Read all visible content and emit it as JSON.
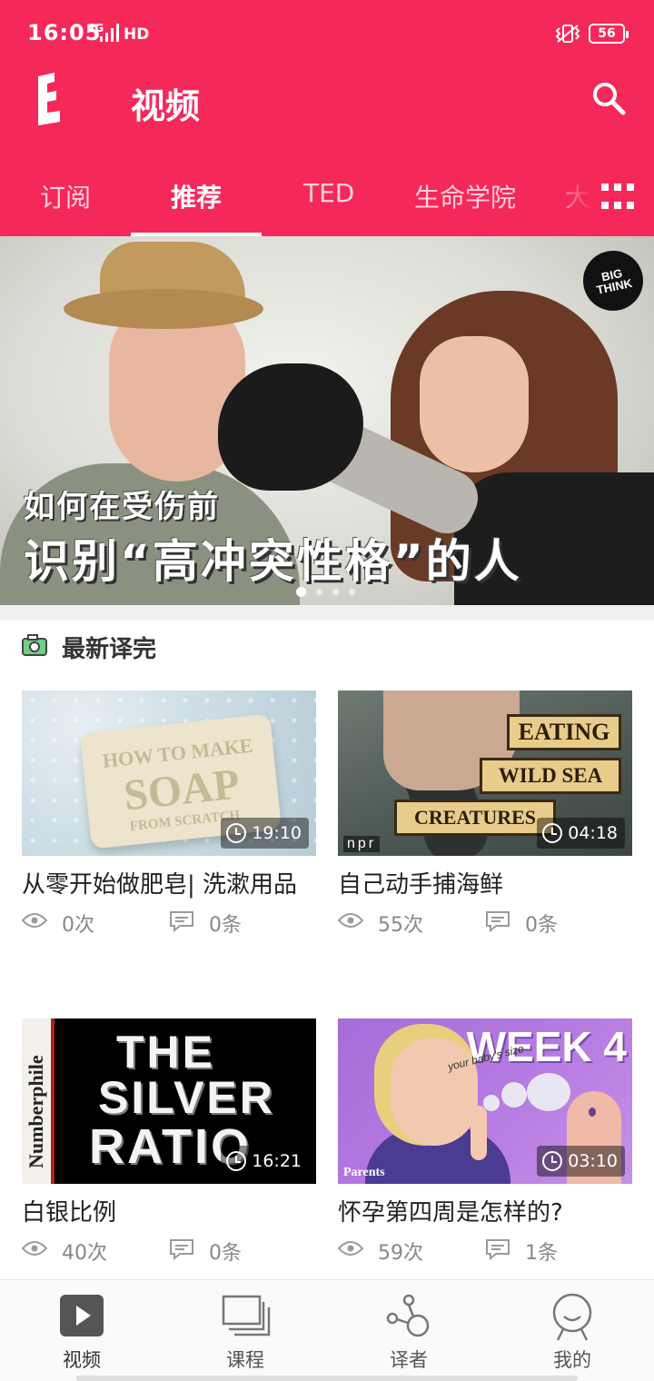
{
  "status_bar": {
    "time": "16:05",
    "network": "4G",
    "hd": "HD",
    "battery": "56"
  },
  "header": {
    "title": "视频"
  },
  "tabs": [
    {
      "label": "订阅",
      "active": false
    },
    {
      "label": "推荐",
      "active": true
    },
    {
      "label": "TED",
      "active": false
    },
    {
      "label": "生命学院",
      "active": false
    },
    {
      "label": "大",
      "active": false
    }
  ],
  "banner": {
    "line1": "如何在受伤前",
    "line2": "识别“高冲突性格”的人",
    "badge": "BIG THINK",
    "dots": 4,
    "active_dot": 0
  },
  "section": {
    "title": "最新译完"
  },
  "videos": [
    {
      "title": "从零开始做肥皂| 洗漱用品",
      "duration": "19:10",
      "views": "0次",
      "comments": "0条",
      "thumb_text": [
        "HOW TO MAKE",
        "SOAP",
        "FROM SCRATCH"
      ]
    },
    {
      "title": "自己动手捕海鲜",
      "duration": "04:18",
      "views": "55次",
      "comments": "0条",
      "thumb_text": [
        "EATING",
        "WILD SEA",
        "CREATURES",
        "npr"
      ]
    },
    {
      "title": "白银比例",
      "duration": "16:21",
      "views": "40次",
      "comments": "0条",
      "thumb_text": [
        "Numberphile",
        "THE",
        "SILVER",
        "RATIO"
      ]
    },
    {
      "title": "怀孕第四周是怎样的?",
      "duration": "03:10",
      "views": "59次",
      "comments": "1条",
      "thumb_text": [
        "WEEK 4",
        "your baby's size",
        "Parents"
      ]
    }
  ],
  "bottom_nav": [
    {
      "label": "视频",
      "icon": "video-play-icon",
      "active": true
    },
    {
      "label": "课程",
      "icon": "courses-icon",
      "active": false
    },
    {
      "label": "译者",
      "icon": "translator-network-icon",
      "active": false
    },
    {
      "label": "我的",
      "icon": "profile-icon",
      "active": false
    }
  ],
  "colors": {
    "brand": "#f5285a",
    "text": "#222222",
    "muted": "#888888"
  }
}
